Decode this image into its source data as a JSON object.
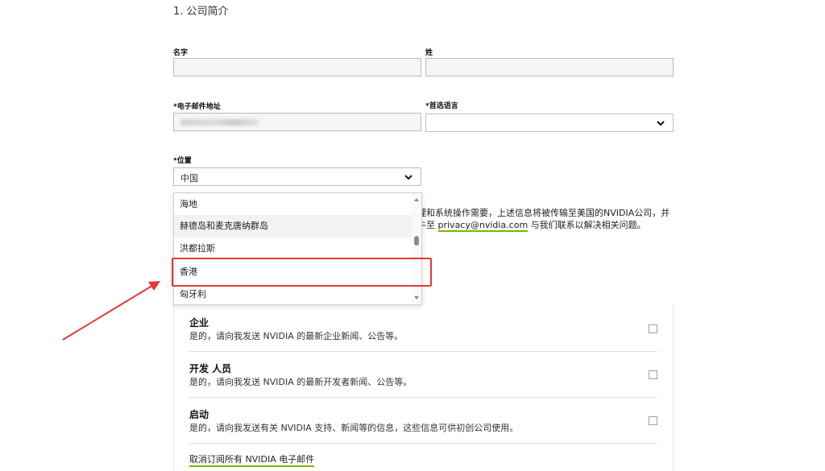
{
  "form": {
    "section_title": "1. 公司简介",
    "first_name": {
      "label": "名字",
      "value": ""
    },
    "last_name": {
      "label": "姓",
      "value": ""
    },
    "email": {
      "label": "*电子邮件地址"
    },
    "language": {
      "label": "*首选语言",
      "value": ""
    },
    "location": {
      "label": "*位置",
      "value": "中国",
      "options": [
        "海地",
        "赫德岛和麦克唐纳群岛",
        "洪都拉斯",
        "香港",
        "匈牙利"
      ],
      "highlighted_option": "香港"
    }
  },
  "privacy": {
    "line1": "理和系统操作需要，上述信息将被传输至美国的NVIDIA公司，并",
    "line2_prefix": "牛至 ",
    "link": "privacy@nvidia.com",
    "line2_suffix": " 与我们联系以解决相关问题。"
  },
  "subscriptions": [
    {
      "title": "企业",
      "desc": "是的，请向我发送 NVIDIA 的最新企业新闻、公告等。"
    },
    {
      "title": "开发 人员",
      "desc": "是的，请向我发送 NVIDIA 的最新开发者新闻、公告等。"
    },
    {
      "title": "启动",
      "desc": "是的，请向我发送有关 NVIDIA 支持、新闻等的信息，这些信息可供初创公司使用。"
    }
  ],
  "unsubscribe_link": "取消订阅所有 NVIDIA 电子邮件",
  "colors": {
    "highlight": "#e53935",
    "link_underline": "#76b900"
  }
}
